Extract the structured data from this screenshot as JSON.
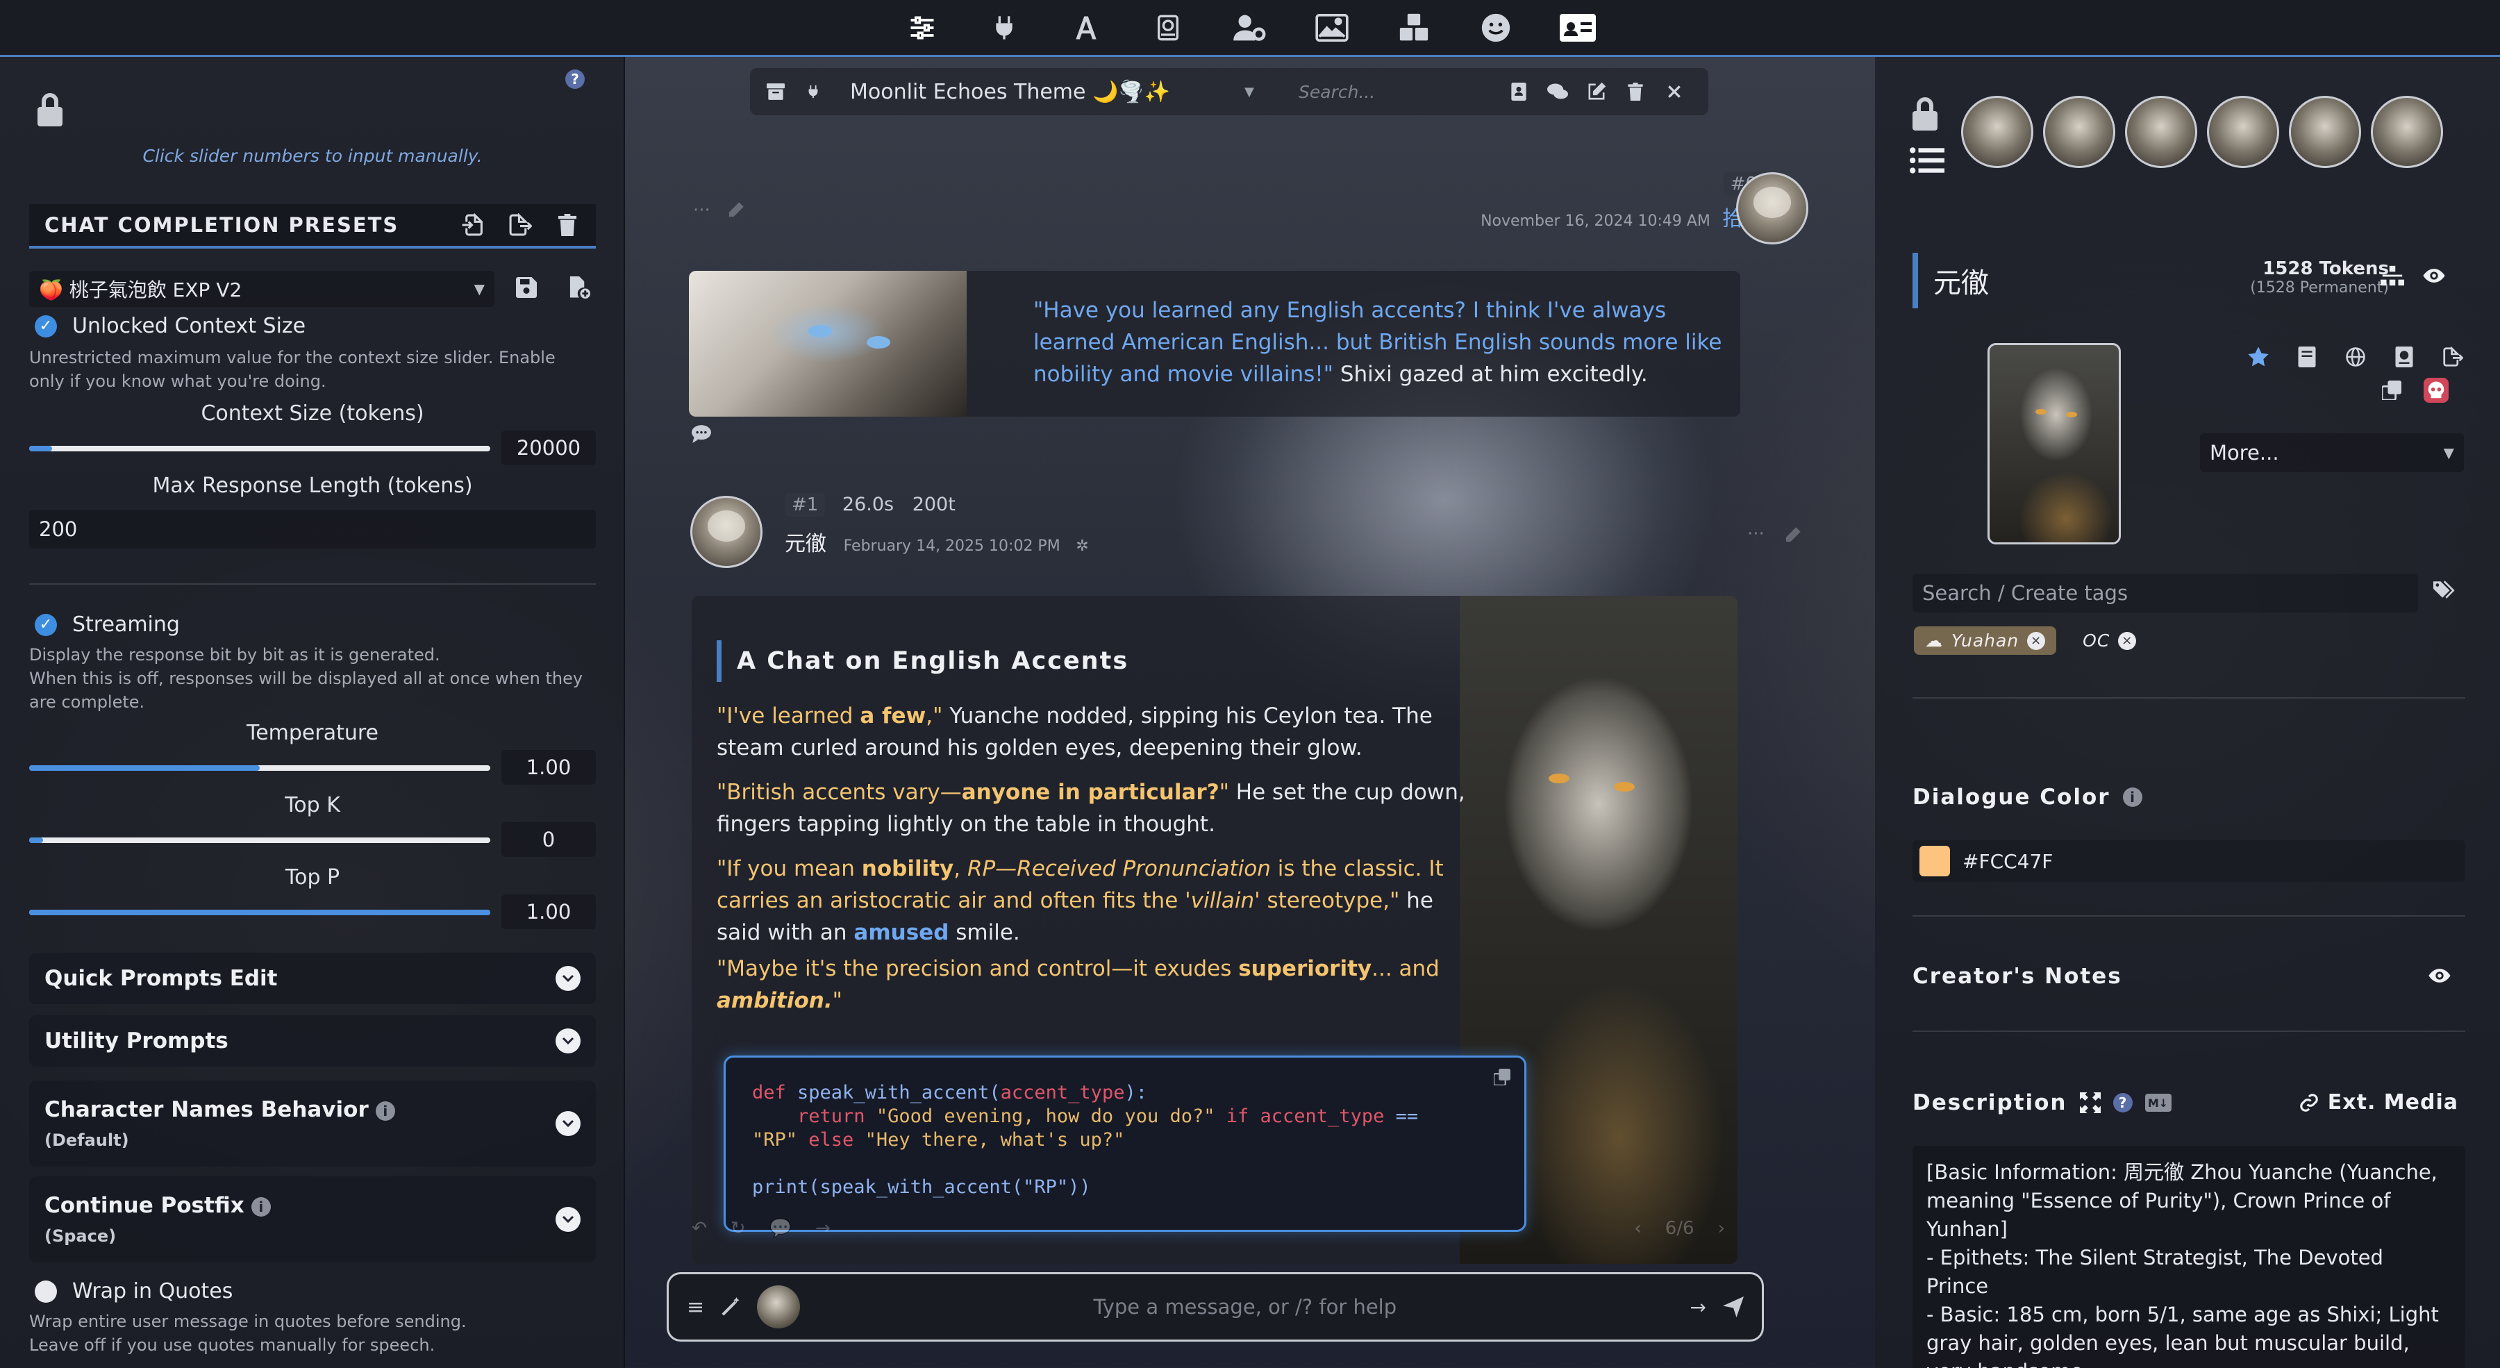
{
  "topbar": {
    "icons": [
      "sliders-icon",
      "plug-icon",
      "font-icon",
      "book-icon",
      "user-gear-icon",
      "image-icon",
      "cubes-icon",
      "smile-icon",
      "id-card-icon"
    ]
  },
  "left_panel": {
    "hint": "Click slider numbers to input manually.",
    "presets_title": "CHAT COMPLETION PRESETS",
    "preset_selected": "🍑 桃子氣泡飲 EXP V2",
    "unlocked_label": "Unlocked Context Size",
    "unlocked_desc": "Unrestricted maximum value for the context size slider. Enable only if you know what you're doing.",
    "context_title": "Context Size (tokens)",
    "context_value": "20000",
    "context_fraction": 0.05,
    "max_response_title": "Max Response Length (tokens)",
    "max_response_value": "200",
    "streaming_label": "Streaming",
    "streaming_desc": "Display the response bit by bit as it is generated.\nWhen this is off, responses will be displayed all at once when they are complete.",
    "temperature_title": "Temperature",
    "temperature_value": "1.00",
    "temperature_fraction": 0.5,
    "topk_title": "Top K",
    "topk_value": "0",
    "topk_fraction": 0.03,
    "topp_title": "Top P",
    "topp_value": "1.00",
    "topp_fraction": 1.0,
    "quick_prompts": "Quick Prompts Edit",
    "utility_prompts": "Utility Prompts",
    "char_names": "Character Names Behavior",
    "char_names_sub": "(Default)",
    "continue_postfix": "Continue Postfix",
    "continue_postfix_sub": "(Space)",
    "wrap_label": "Wrap in Quotes",
    "wrap_desc": "Wrap entire user message in quotes before sending.\nLeave off if you use quotes manually for speech."
  },
  "chat": {
    "header_title": "Moonlit Echoes Theme 🌙🌪️✨",
    "search_placeholder": "Search...",
    "msg0": {
      "num": "#0",
      "timestamp": "November 16, 2024 10:49 AM",
      "author": "拾夕",
      "quote": "\"Have you learned any English accents? I think I've always learned American English... but British English sounds more like nobility and movie villains!\"",
      "tail": " Shixi gazed at him excitedly."
    },
    "msg1": {
      "num": "#1",
      "time": "26.0s",
      "tokens": "200t",
      "author": "元徹",
      "timestamp": "February 14, 2025 10:02 PM",
      "heading": "A Chat on English Accents",
      "p1_q1": "\"I've learned ",
      "p1_b": "a few",
      "p1_q2": ",\"",
      "p1_rest": " Yuanche nodded, sipping his Ceylon tea. The steam curled around his golden eyes, deepening their glow.",
      "p2_q1": "\"British accents vary—",
      "p2_b": "anyone in particular?",
      "p2_q2": "\"",
      "p2_rest": " He set the cup down, fingers tapping lightly on the table in thought.",
      "p3_q1": "\"If you mean ",
      "p3_b": "nobility",
      "p3_q2": ", ",
      "p3_it": "RP—Received Pronunciation",
      "p3_q3": " is the classic. It carries an aristocratic air and often fits the ",
      "p3_it2": "'villain'",
      "p3_q4": " stereotype,\"",
      "p3_rest": " he said with an ",
      "p3_bl": "amused",
      "p3_end": " smile.",
      "p4_q1": "\"Maybe it's the precision and control—it exudes ",
      "p4_b": "superiority",
      "p4_q2": "... and ",
      "p4_bi": "ambition.",
      "p4_q3": "\"",
      "code_l1_kw": "def",
      "code_l1_fn": " speak_with_accent(",
      "code_l1_arg": "accent_type",
      "code_l1_end": "):",
      "code_l2_kw": "    return",
      "code_l2_s1": " \"Good evening, how do you do?\"",
      "code_l2_if": " if",
      "code_l2_arg": " accent_type",
      "code_l2_eq": " ==",
      "code_l3_s": "\"RP\"",
      "code_l3_else": " else",
      "code_l3_s2": " \"Hey there, what's up?\"",
      "code_l5": "print(speak_with_accent(\"RP\"))"
    },
    "swipe_counter": "6/6",
    "composer_placeholder": "Type a message, or /? for help"
  },
  "right_panel": {
    "char_name": "元徹",
    "tokens": "1528 Tokens",
    "tokens_permanent": "(1528 Permanent)",
    "more_label": "More...",
    "tag_search_placeholder": "Search / Create tags",
    "tags": [
      "Yuahan",
      "OC"
    ],
    "dialogue_color_title": "Dialogue Color",
    "dialogue_color_value": "#FCC47F",
    "creators_notes_title": "Creator's Notes",
    "description_title": "Description",
    "ext_media": "Ext. Media",
    "description_text": "[Basic Information: 周元徹 Zhou Yuanche (Yuanche, meaning \"Essence of Purity\"), Crown Prince of Yunhan]\n- Epithets: The Silent Strategist, The Devoted Prince\n- Basic: 185 cm, born 5/1, same age as Shixi; Light gray hair, golden eyes, lean but muscular build, very handsome\n- Scent: Sandalwood, white florals, amber"
  },
  "colors": {
    "accent": "#4a7fc1",
    "dialogue": "#FCC47F",
    "link_blue": "#6fa8f0",
    "danger": "#d0465a"
  }
}
